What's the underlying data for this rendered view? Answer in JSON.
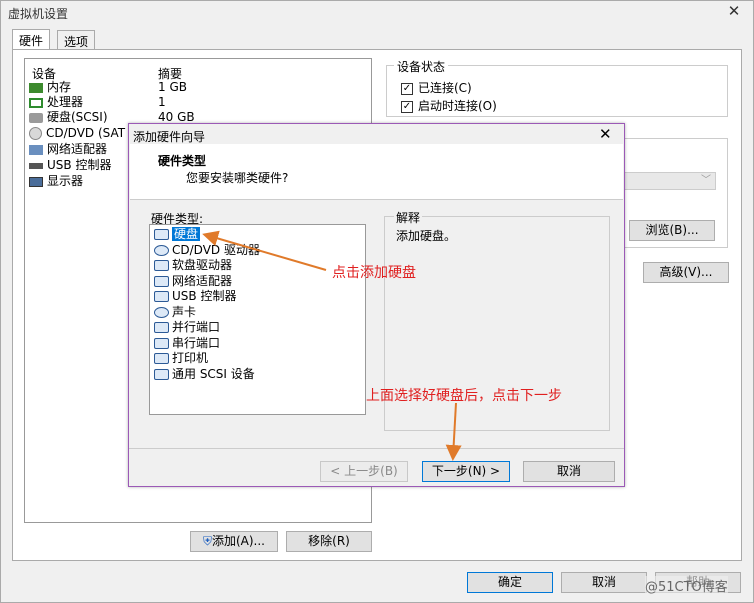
{
  "window": {
    "title": "虚拟机设置"
  },
  "tabs": [
    {
      "label": "硬件"
    },
    {
      "label": "选项"
    }
  ],
  "device_list": {
    "col_device": "设备",
    "col_summary": "摘要",
    "rows": [
      {
        "device": "内存",
        "summary": "1 GB"
      },
      {
        "device": "处理器",
        "summary": "1"
      },
      {
        "device": "硬盘(SCSI)",
        "summary": "40 GB"
      },
      {
        "device": "CD/DVD (SAT",
        "summary": ""
      },
      {
        "device": "网络适配器",
        "summary": ""
      },
      {
        "device": "USB 控制器",
        "summary": ""
      },
      {
        "device": "显示器",
        "summary": ""
      }
    ]
  },
  "device_status": {
    "title": "设备状态",
    "connected": "已连接(C)",
    "connect_on_start": "启动时连接(O)"
  },
  "right_buttons": {
    "browse": "浏览(B)...",
    "advanced": "高级(V)..."
  },
  "bottom_buttons": {
    "add": "添加(A)...",
    "remove": "移除(R)",
    "ok": "确定",
    "cancel": "取消",
    "help": "帮助"
  },
  "watermark": "@51CTO博客",
  "wizard": {
    "title": "添加硬件向导",
    "header_title": "硬件类型",
    "header_subtitle": "您要安装哪类硬件?",
    "list_label": "硬件类型:",
    "items": [
      "硬盘",
      "CD/DVD 驱动器",
      "软盘驱动器",
      "网络适配器",
      "USB 控制器",
      "声卡",
      "并行端口",
      "串行端口",
      "打印机",
      "通用 SCSI 设备"
    ],
    "explain_title": "解释",
    "explain_text": "添加硬盘。",
    "back": "< 上一步(B)",
    "next": "下一步(N) >",
    "cancel": "取消"
  },
  "annotations": {
    "click_add_disk": "点击添加硬盘",
    "after_select": "上面选择好硬盘后，点击下一步"
  },
  "colors": {
    "annotation": "#e02020",
    "selection": "#0078d7",
    "wizard_border": "#9b59b6"
  }
}
